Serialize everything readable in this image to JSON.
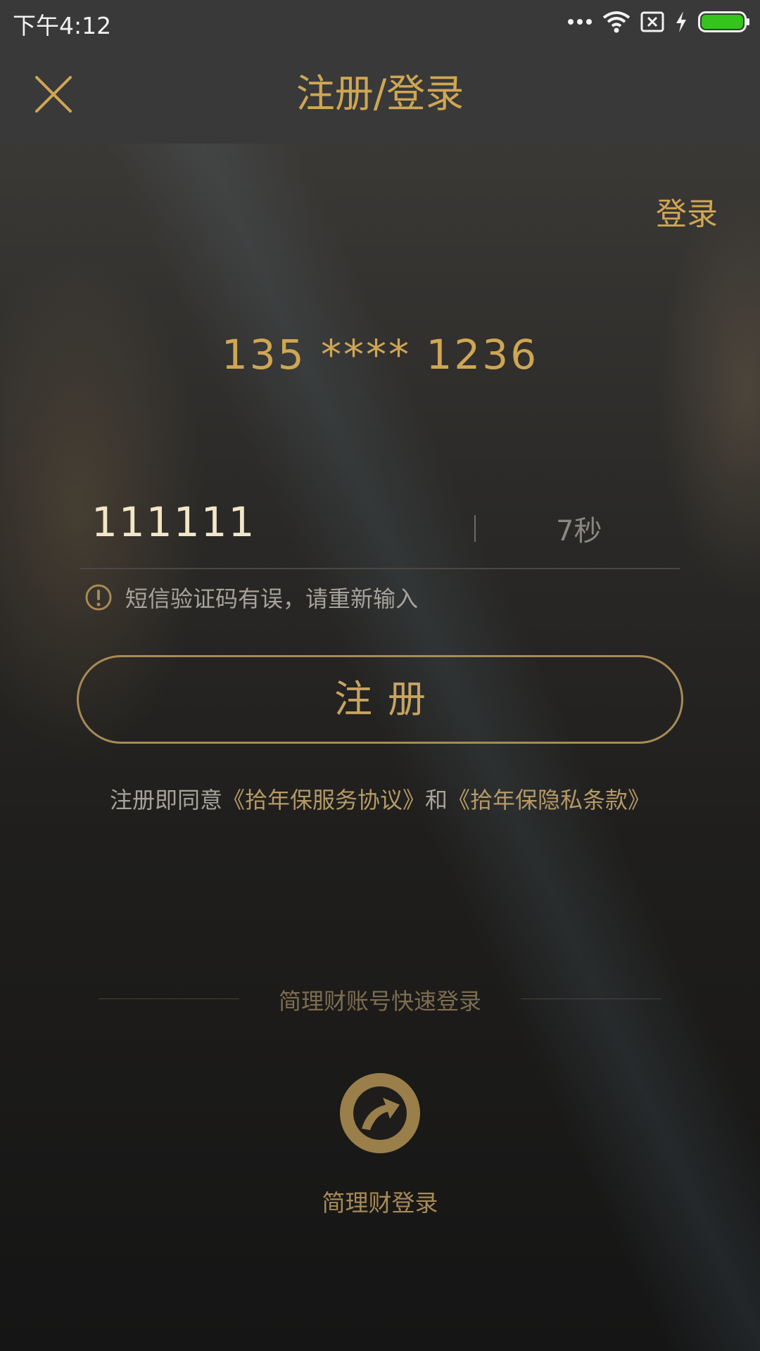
{
  "status_bar": {
    "time": "下午4:12",
    "icons": [
      "more-icon",
      "wifi-icon",
      "no-sim-icon",
      "charging-icon",
      "battery-icon"
    ]
  },
  "header": {
    "title": "注册/登录",
    "close_icon": "close-icon"
  },
  "login_link": "登录",
  "phone_number": "135 **** 1236",
  "verification": {
    "code_value": "111111",
    "countdown": "7秒"
  },
  "error": {
    "icon": "alert-circle-icon",
    "message": "短信验证码有误，请重新输入"
  },
  "register_button": "注册",
  "agreement": {
    "prefix": "注册即同意",
    "service_link": "《拾年保服务协议》",
    "and": "和",
    "privacy_link": "《拾年保隐私条款》"
  },
  "quick_login": {
    "label": "简理财账号快速登录",
    "app_icon": "jianlicai-arrow-icon",
    "app_label": "简理财登录"
  },
  "colors": {
    "gold": "#cfa653",
    "muted_gold": "#a88a55",
    "header_bg": "#393939",
    "battery": "#35c41c"
  }
}
